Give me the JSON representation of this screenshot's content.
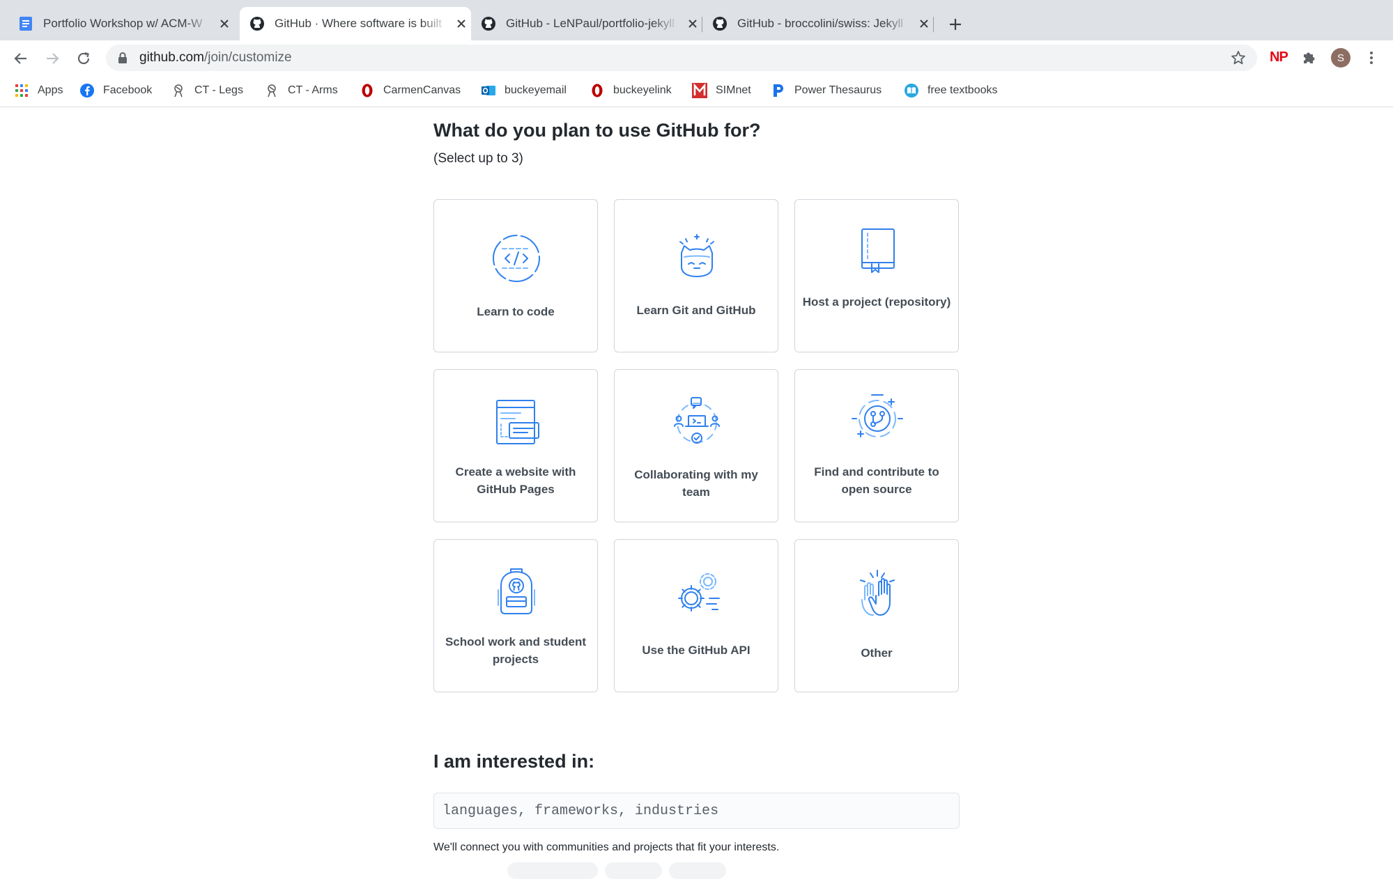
{
  "browser": {
    "tabs": [
      {
        "title": "Portfolio Workshop w/ ACM-W",
        "icon": "docs-icon"
      },
      {
        "title": "GitHub · Where software is built",
        "icon": "github-icon",
        "active": true
      },
      {
        "title": "GitHub - LeNPaul/portfolio-jekyll",
        "icon": "github-icon"
      },
      {
        "title": "GitHub - broccolini/swiss: Jekyll",
        "icon": "github-icon"
      }
    ],
    "url_host": "github.com",
    "url_path": "/join/customize",
    "extension_label": "NP",
    "avatar_letter": "S",
    "bookmarks": [
      {
        "label": "Apps",
        "icon": "apps-grid-icon"
      },
      {
        "label": "Facebook",
        "icon": "facebook-icon"
      },
      {
        "label": "CT - Legs",
        "icon": "drawing-icon"
      },
      {
        "label": "CT - Arms",
        "icon": "drawing-icon"
      },
      {
        "label": "CarmenCanvas",
        "icon": "osu-icon"
      },
      {
        "label": "buckeyemail",
        "icon": "outlook-icon"
      },
      {
        "label": "buckeyelink",
        "icon": "osu-icon"
      },
      {
        "label": "SIMnet",
        "icon": "simnet-icon"
      },
      {
        "label": "Power Thesaurus",
        "icon": "thesaurus-icon"
      },
      {
        "label": "free textbooks",
        "icon": "textbook-icon"
      }
    ]
  },
  "page": {
    "title": "What do you plan to use GitHub for?",
    "subtitle": "(Select up to 3)",
    "options": [
      {
        "label": "Learn to code",
        "icon": "code-icon"
      },
      {
        "label": "Learn Git and GitHub",
        "icon": "octocat-icon"
      },
      {
        "label": "Host a project (repository)",
        "icon": "repository-icon"
      },
      {
        "label": "Create a website with GitHub Pages",
        "icon": "website-icon"
      },
      {
        "label": "Collaborating with my team",
        "icon": "team-icon"
      },
      {
        "label": "Find and contribute to open source",
        "icon": "open-source-icon"
      },
      {
        "label": "School work and student projects",
        "icon": "backpack-icon"
      },
      {
        "label": "Use the GitHub API",
        "icon": "gears-icon"
      },
      {
        "label": "Other",
        "icon": "high-five-icon"
      }
    ],
    "interests": {
      "title": "I am interested in:",
      "placeholder": "languages, frameworks, industries",
      "helper": "We'll connect you with communities and projects that fit your interests."
    }
  },
  "colors": {
    "accent": "#2f80ed",
    "text": "#24292e",
    "border": "#d1d5da"
  }
}
